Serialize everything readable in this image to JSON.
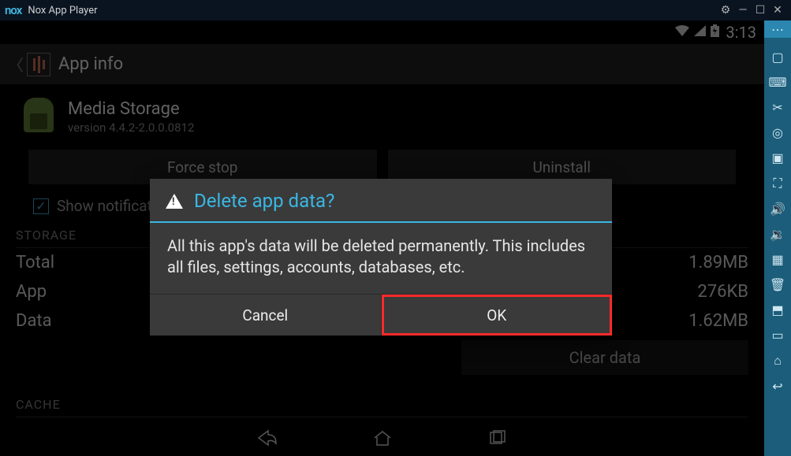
{
  "window": {
    "logo": "nox",
    "title": "Nox App Player"
  },
  "status": {
    "clock": "3:13"
  },
  "actionbar": {
    "title": "App info"
  },
  "app": {
    "name": "Media Storage",
    "version": "version 4.4.2-2.0.0.0812"
  },
  "buttons": {
    "force_stop": "Force stop",
    "uninstall": "Uninstall"
  },
  "checkbox": {
    "show_notifications": "Show notifications"
  },
  "sections": {
    "storage": "STORAGE",
    "cache": "CACHE"
  },
  "storage": {
    "rows": [
      {
        "label": "Total",
        "value": "1.89MB"
      },
      {
        "label": "App",
        "value": "276KB"
      },
      {
        "label": "Data",
        "value": "1.62MB"
      }
    ],
    "clear_data": "Clear data"
  },
  "dialog": {
    "title": "Delete app data?",
    "message": "All this app's data will be deleted permanently. This includes all files, settings, accounts, databases, etc.",
    "cancel": "Cancel",
    "ok": "OK"
  }
}
